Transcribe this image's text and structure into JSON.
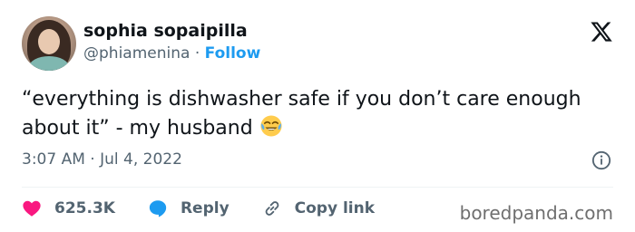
{
  "user": {
    "display_name": "sophia sopaipilla",
    "handle": "@phiamenina",
    "separator": " · ",
    "follow_label": "Follow"
  },
  "tweet": {
    "text": "“everything is dishwasher safe if you don’t care enough about it” - my husband",
    "emoji_icon": "face-with-tears-of-joy-icon"
  },
  "meta": {
    "timestamp": "3:07 AM · Jul 4, 2022"
  },
  "actions": {
    "like_count": "625.3K",
    "reply_label": "Reply",
    "copy_link_label": "Copy link"
  },
  "watermark": "boredpanda.com",
  "colors": {
    "link_blue": "#1d9bf0",
    "like_pink": "#f91880",
    "muted": "#536471",
    "text": "#0f1419"
  }
}
